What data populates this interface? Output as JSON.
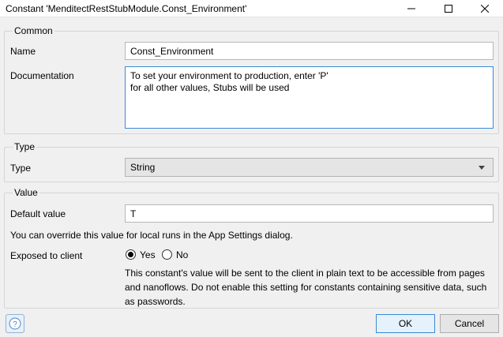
{
  "window": {
    "title": "Constant 'MenditectRestStubModule.Const_Environment'"
  },
  "common": {
    "group_label": "Common",
    "name_label": "Name",
    "name_value": "Const_Environment",
    "documentation_label": "Documentation",
    "documentation_lines": [
      "To set your environment to production, enter 'P'",
      "for all other values, Stubs will be used"
    ]
  },
  "type": {
    "group_label": "Type",
    "type_label": "Type",
    "type_value": "String"
  },
  "value": {
    "group_label": "Value",
    "default_label": "Default value",
    "default_value": "T",
    "override_note": "You can override this value for local runs in the App Settings dialog.",
    "exposed_label": "Exposed to client",
    "yes_label": "Yes",
    "no_label": "No",
    "exposed_selected": "Yes",
    "exposed_note_lines": [
      "This constant's value will be sent to the client in plain text to be accessible from pages",
      "and nanoflows. Do not enable this setting for constants containing sensitive data, such",
      "as passwords."
    ]
  },
  "footer": {
    "ok_label": "OK",
    "cancel_label": "Cancel",
    "help_icon": "help-icon"
  },
  "colors": {
    "focus_border": "#3b8ad8",
    "background": "#f0f0f0"
  }
}
